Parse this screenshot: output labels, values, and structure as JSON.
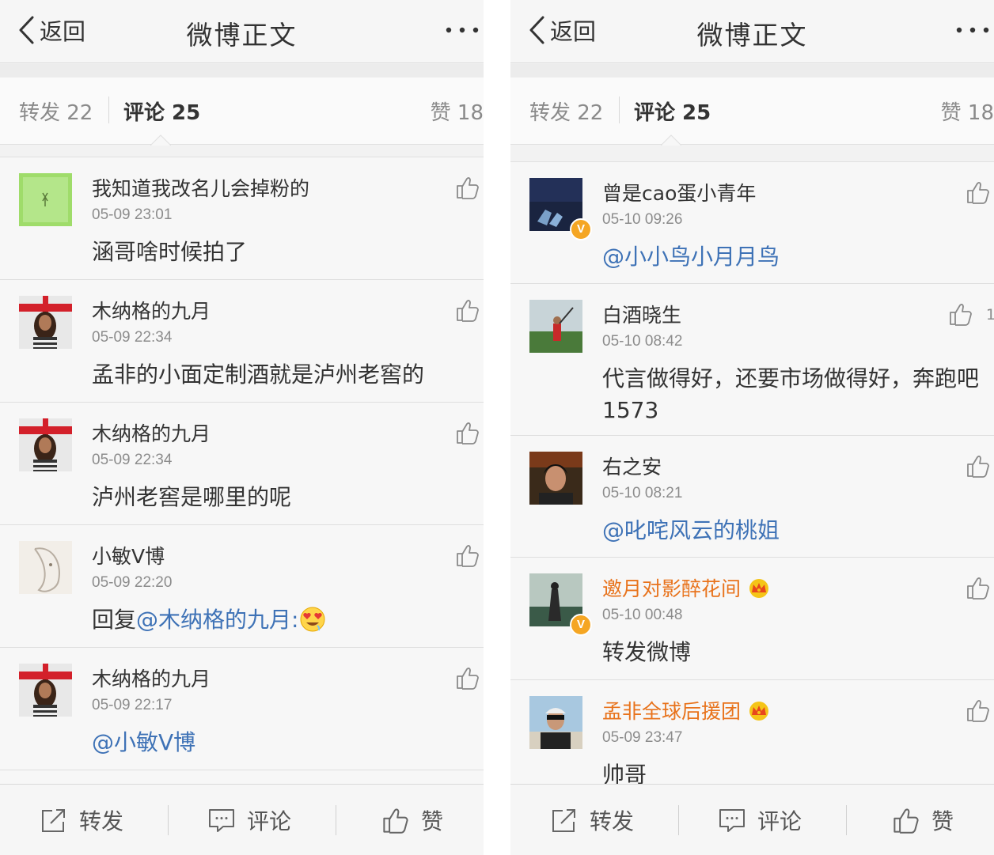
{
  "left": {
    "nav": {
      "back_label": "返回",
      "title": "微博正文"
    },
    "tabs": {
      "repost": "转发 22",
      "comments": "评论 25",
      "likes": "赞 18"
    },
    "comments": [
      {
        "name": "我知道我改名儿会掉粉的",
        "time": "05-09 23:01",
        "text": "涵哥啥时候拍了"
      },
      {
        "name": "木纳格的九月",
        "time": "05-09 22:34",
        "text": "孟非的小面定制酒就是泸州老窖的"
      },
      {
        "name": "木纳格的九月",
        "time": "05-09 22:34",
        "text": "泸州老窖是哪里的呢"
      },
      {
        "name": "小敏V博",
        "time": "05-09 22:20",
        "text_prefix": "回复",
        "mention": "@木纳格的九月",
        "text_suffix": ":"
      },
      {
        "name": "木纳格的九月",
        "time": "05-09 22:17",
        "mention": "@小敏V博"
      }
    ],
    "toolbar": {
      "repost": "转发",
      "comment": "评论",
      "like": "赞"
    }
  },
  "right": {
    "nav": {
      "back_label": "返回",
      "title": "微博正文"
    },
    "tabs": {
      "repost": "转发 22",
      "comments": "评论 25",
      "likes": "赞 18"
    },
    "comments": [
      {
        "name": "曾是cao蛋小青年",
        "time": "05-10 09:26",
        "mention": "@小小鸟小月月鸟",
        "verified": true
      },
      {
        "name": "白酒晓生",
        "time": "05-10 08:42",
        "text": "代言做得好，还要市场做得好，奔跑吧1573",
        "likes": "1"
      },
      {
        "name": "右之安",
        "time": "05-10 08:21",
        "mention": "@叱咤风云的桃姐"
      },
      {
        "name": "邀月对影醉花间",
        "time": "05-10 00:48",
        "text": "转发微博",
        "verified": true,
        "vip": true
      },
      {
        "name": "孟非全球后援团",
        "time": "05-09 23:47",
        "text": "帅哥",
        "vip": true
      }
    ],
    "toolbar": {
      "repost": "转发",
      "comment": "评论",
      "like": "赞"
    }
  },
  "colors": {
    "mention": "#3e72b6",
    "vip_name": "#e8731c",
    "verified_badge": "#f5a623"
  },
  "icons": [
    "chevron-left-icon",
    "more-dots-icon",
    "thumbs-up-icon",
    "share-icon",
    "comment-icon",
    "crown-icon",
    "heart-eyes-emoji"
  ]
}
